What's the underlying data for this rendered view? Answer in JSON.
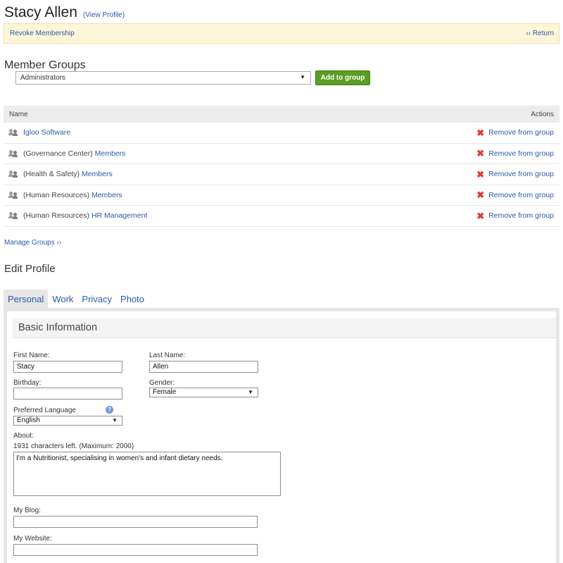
{
  "header": {
    "name": "Stacy Allen",
    "view_profile": "(View Profile)"
  },
  "notice": {
    "revoke": "Revoke Membership",
    "return": "‹‹ Return"
  },
  "member_groups": {
    "title": "Member Groups",
    "selected": "Administrators",
    "add_button": "Add to group",
    "columns": {
      "name": "Name",
      "actions": "Actions"
    },
    "rows": [
      {
        "prefix": "",
        "link": "Igloo Software",
        "action": "Remove from group"
      },
      {
        "prefix": "(Governance Center)",
        "link": "Members",
        "action": "Remove from group"
      },
      {
        "prefix": "(Health & Safety)",
        "link": "Members",
        "action": "Remove from group"
      },
      {
        "prefix": "(Human Resources)",
        "link": "Members",
        "action": "Remove from group"
      },
      {
        "prefix": "(Human Resources)",
        "link": "HR Management",
        "action": "Remove from group"
      }
    ],
    "manage_link": "Manage Groups ››"
  },
  "edit_profile": {
    "title": "Edit Profile",
    "tabs": [
      "Personal",
      "Work",
      "Privacy",
      "Photo"
    ],
    "active_tab": "Personal",
    "section_title": "Basic Information",
    "fields": {
      "first_name_label": "First Name:",
      "first_name_value": "Stacy",
      "last_name_label": "Last Name:",
      "last_name_value": "Allen",
      "birthday_label": "Birthday:",
      "birthday_value": "",
      "gender_label": "Gender:",
      "gender_value": "Female",
      "language_label": "Preferred Language",
      "language_value": "English",
      "about_label": "About:",
      "about_counter": "1931 characters left. (Maximum: 2000)",
      "about_value": "I'm a Nutritionist, specialising in women's and infant dietary needs.",
      "blog_label": "My Blog:",
      "blog_value": "",
      "website_label": "My Website:",
      "website_value": ""
    }
  },
  "colors": {
    "link": "#2a5aa8",
    "add_button": "#5a9e24",
    "notice_bg": "#fdf6d8",
    "remove_icon": "#e23b2e"
  }
}
